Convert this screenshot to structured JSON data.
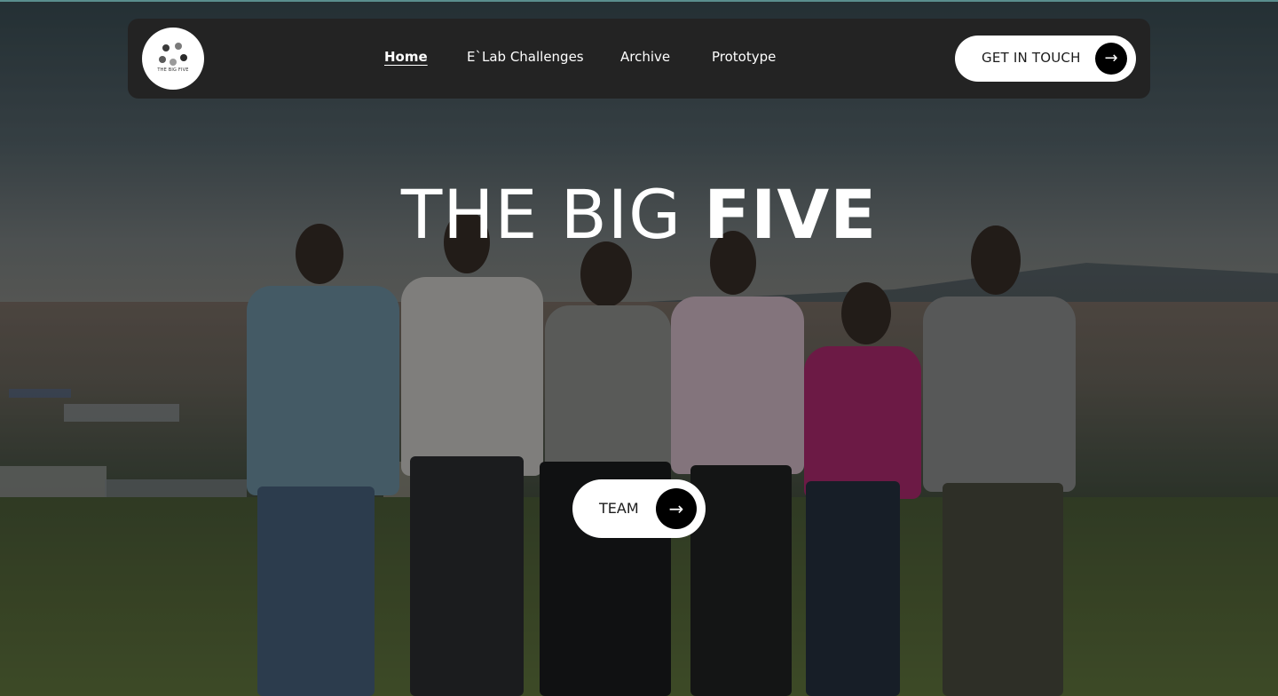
{
  "brand": {
    "logo_text": "THE BIG FIVE",
    "logo_dot_colors": [
      "#3a3a3a",
      "#7a7a7a",
      "#5a5a5a",
      "#9a9a9a",
      "#2a2a2a"
    ]
  },
  "nav": {
    "items": [
      {
        "label": "Home",
        "active": true
      },
      {
        "label": "E`Lab Challenges",
        "active": false
      },
      {
        "label": "Archive",
        "active": false
      },
      {
        "label": "Prototype",
        "active": false
      }
    ],
    "cta_label": "GET IN TOUCH",
    "cta_icon": "arrow-right-icon"
  },
  "hero": {
    "title_light": "THE BIG ",
    "title_bold": "FIVE",
    "button_label": "TEAM",
    "button_icon": "arrow-right-icon",
    "background": "group-photo"
  },
  "colors": {
    "nav_bg": "#232323",
    "button_bg": "#ffffff",
    "icon_circle": "#000000",
    "text_light": "#ffffff"
  }
}
